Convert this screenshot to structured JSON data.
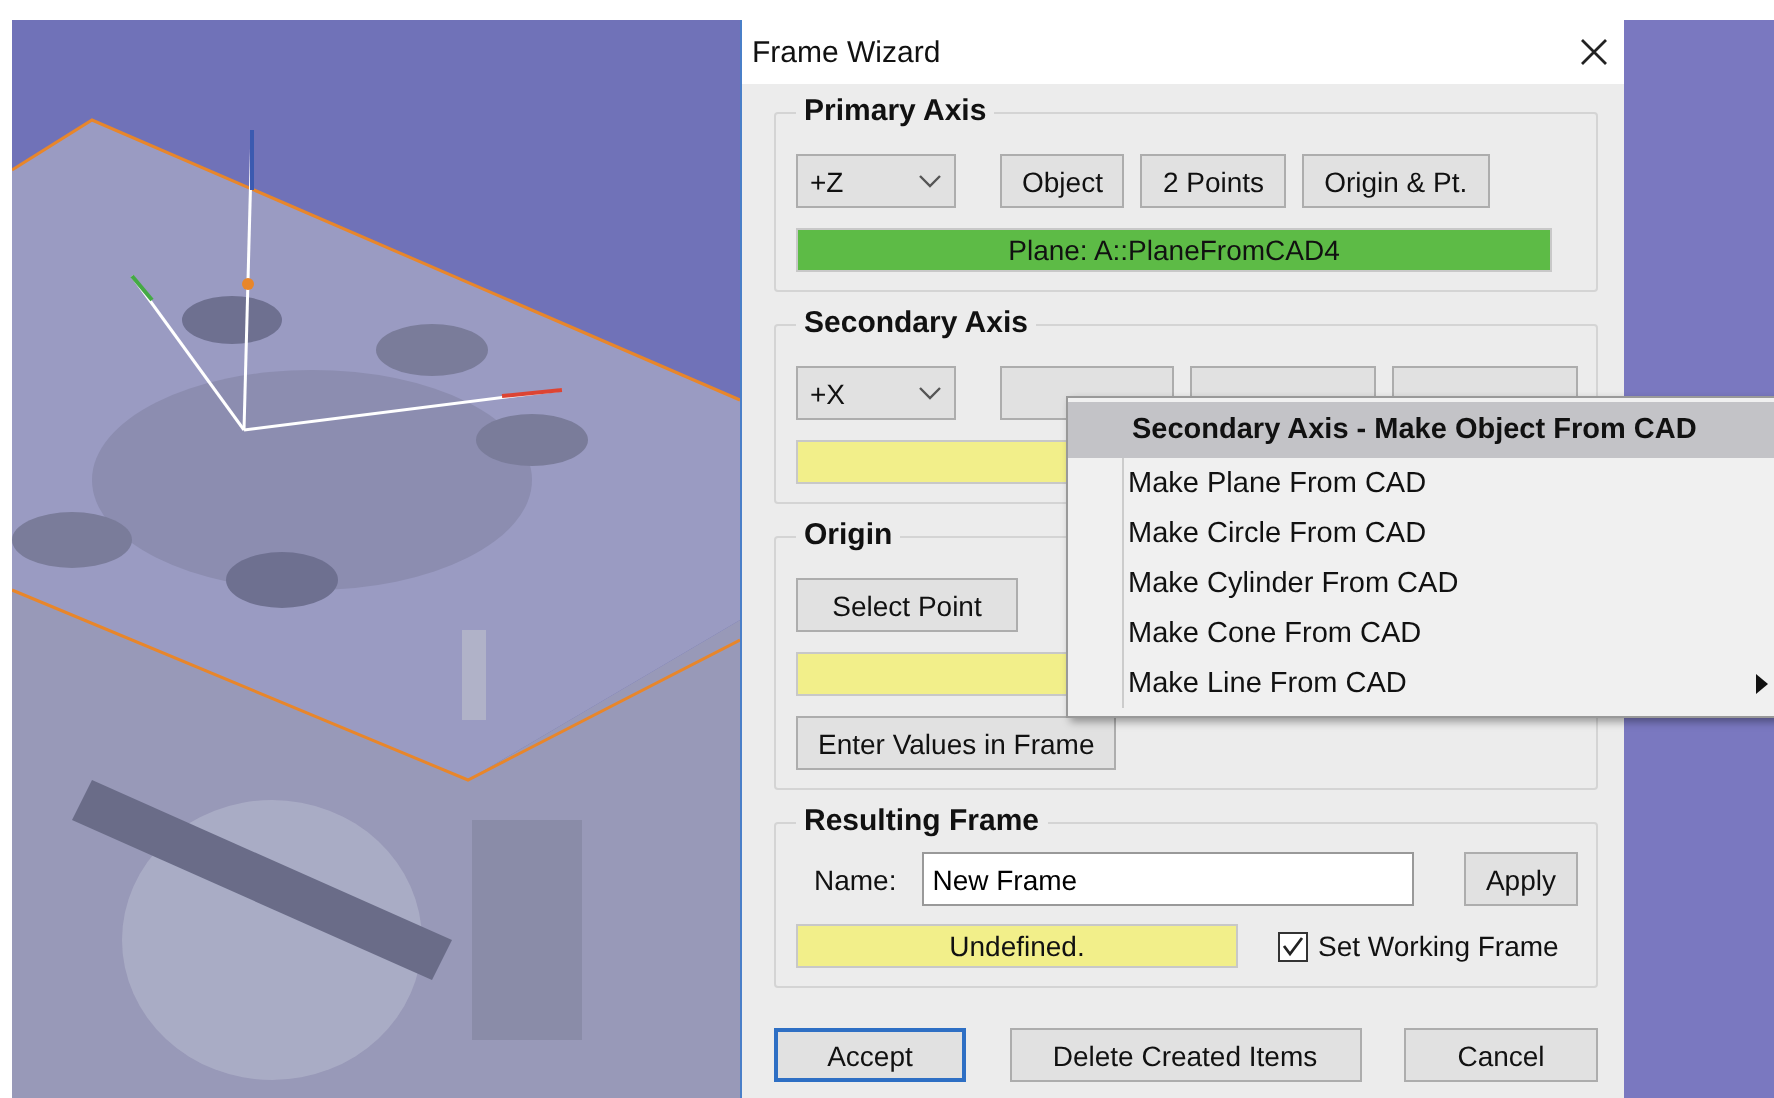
{
  "window": {
    "title": "Frame Wizard"
  },
  "primary_axis": {
    "title": "Primary Axis",
    "direction": "+Z",
    "buttons": [
      "Object",
      "2 Points",
      "Origin & Pt."
    ],
    "status": {
      "text": "Plane: A::PlaneFromCAD4",
      "defined": true
    }
  },
  "secondary_axis": {
    "title": "Secondary Axis",
    "direction": "+X",
    "status": {
      "defined": false
    }
  },
  "origin": {
    "title": "Origin",
    "buttons": [
      "Select Point",
      "Enter Values in Frame"
    ],
    "status": {
      "defined": false
    }
  },
  "resulting_frame": {
    "title": "Resulting Frame",
    "name_label": "Name:",
    "name_value": "New Frame",
    "apply": "Apply",
    "status": {
      "text": "Undefined.",
      "defined": false
    },
    "set_working_frame": {
      "label": "Set Working Frame",
      "checked": true
    }
  },
  "footer_buttons": [
    {
      "label": "Accept",
      "default": true
    },
    {
      "label": "Delete Created Items",
      "default": false
    },
    {
      "label": "Cancel",
      "default": false
    }
  ],
  "context_menu": {
    "title": "Secondary Axis - Make Object From CAD",
    "items": [
      {
        "label": "Make Plane From CAD",
        "submenu": false
      },
      {
        "label": "Make Circle From CAD",
        "submenu": false
      },
      {
        "label": "Make Cylinder From CAD",
        "submenu": false
      },
      {
        "label": "Make Cone From CAD",
        "submenu": false
      },
      {
        "label": "Make Line From CAD",
        "submenu": true
      }
    ]
  }
}
